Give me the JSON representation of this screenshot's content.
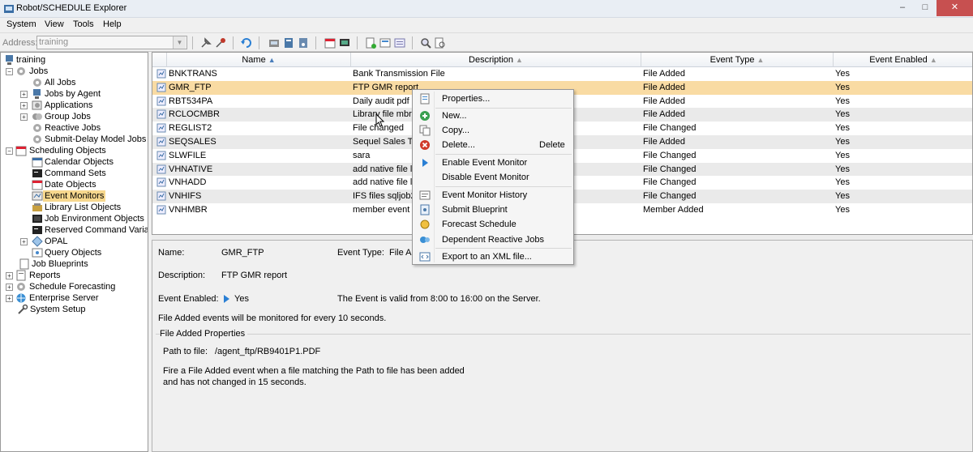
{
  "window": {
    "title": "Robot/SCHEDULE Explorer",
    "min_glyph": "–",
    "max_glyph": "□",
    "close_glyph": "✕"
  },
  "menu": {
    "items": [
      "System",
      "View",
      "Tools",
      "Help"
    ]
  },
  "toolbar": {
    "address_label": "Address:",
    "address_value": "training",
    "dropdown_glyph": "▼"
  },
  "tree": {
    "root": "training",
    "nodes": [
      "Jobs",
      "All Jobs",
      "Jobs by Agent",
      "Applications",
      "Group Jobs",
      "Reactive Jobs",
      "Submit-Delay Model Jobs",
      "Scheduling Objects",
      "Calendar Objects",
      "Command Sets",
      "Date Objects",
      "Event Monitors",
      "Library List Objects",
      "Job Environment Objects",
      "Reserved Command Variab",
      "OPAL",
      "Query Objects",
      "Job Blueprints",
      "Reports",
      "Schedule Forecasting",
      "Enterprise Server",
      "System Setup"
    ],
    "expand_glyphs": {
      "expanded": "−",
      "collapsed": "+"
    }
  },
  "list": {
    "columns": [
      "Name",
      "Description",
      "Event Type",
      "Event Enabled"
    ],
    "sort_glyph": "▲",
    "rows": [
      {
        "name": "BNKTRANS",
        "description": "Bank Transmission File",
        "event_type": "File Added",
        "enabled": "Yes"
      },
      {
        "name": "GMR_FTP",
        "description": "FTP GMR report",
        "event_type": "File Added",
        "enabled": "Yes"
      },
      {
        "name": "RBT534PA",
        "description": "Daily audit pdf -",
        "event_type": "File Added",
        "enabled": "Yes"
      },
      {
        "name": "RCLOCMBR",
        "description": "Library file mbrs",
        "event_type": "File Added",
        "enabled": "Yes"
      },
      {
        "name": "REGLIST2",
        "description": "File changed",
        "event_type": "File Changed",
        "enabled": "Yes"
      },
      {
        "name": "SEQSALES",
        "description": "Sequel Sales Tra",
        "event_type": "File Added",
        "enabled": "Yes"
      },
      {
        "name": "SLWFILE",
        "description": "sara",
        "event_type": "File Changed",
        "enabled": "Yes"
      },
      {
        "name": "VHNATIVE",
        "description": "add native file la",
        "event_type": "File Changed",
        "enabled": "Yes"
      },
      {
        "name": "VNHADD",
        "description": "add native file la",
        "event_type": "File Changed",
        "enabled": "Yes"
      },
      {
        "name": "VNHIFS",
        "description": "IFS files sqljob2",
        "event_type": "File Changed",
        "enabled": "Yes"
      },
      {
        "name": "VNHMBR",
        "description": "member event",
        "event_type": "Member Added",
        "enabled": "Yes"
      }
    ]
  },
  "details": {
    "name_label": "Name:",
    "name_value": "GMR_FTP",
    "event_type_label": "Event Type:",
    "event_type_value": "File Ad",
    "description_label": "Description:",
    "description_value": "FTP GMR report",
    "enabled_label": "Event Enabled:",
    "enabled_value": "Yes",
    "valid_text": "The Event is valid from 8:00 to 16:00 on the Server.",
    "monitor_text": "File Added events will be monitored for every 10 seconds.",
    "group_title": "File Added Properties",
    "path_label": "Path to file:",
    "path_value": "/agent_ftp/RB9401P1.PDF",
    "fire_line1": "Fire a File Added event when a file matching the Path to file has been added",
    "fire_line2": "and has not changed in 15 seconds."
  },
  "context_menu": {
    "items": [
      {
        "label": "Properties...",
        "shortcut": ""
      },
      {
        "label": "New...",
        "shortcut": ""
      },
      {
        "label": "Copy...",
        "shortcut": ""
      },
      {
        "label": "Delete...",
        "shortcut": "Delete"
      },
      {
        "label": "Enable Event Monitor",
        "shortcut": ""
      },
      {
        "label": "Disable Event Monitor",
        "shortcut": ""
      },
      {
        "label": "Event Monitor History",
        "shortcut": ""
      },
      {
        "label": "Submit Blueprint",
        "shortcut": ""
      },
      {
        "label": "Forecast Schedule",
        "shortcut": ""
      },
      {
        "label": "Dependent Reactive Jobs",
        "shortcut": ""
      },
      {
        "label": "Export to an XML file...",
        "shortcut": ""
      }
    ]
  },
  "colors": {
    "selection": "#f9dba3",
    "tree_selection": "#f7d88e",
    "sort_arrow": "#4a7ebb"
  }
}
